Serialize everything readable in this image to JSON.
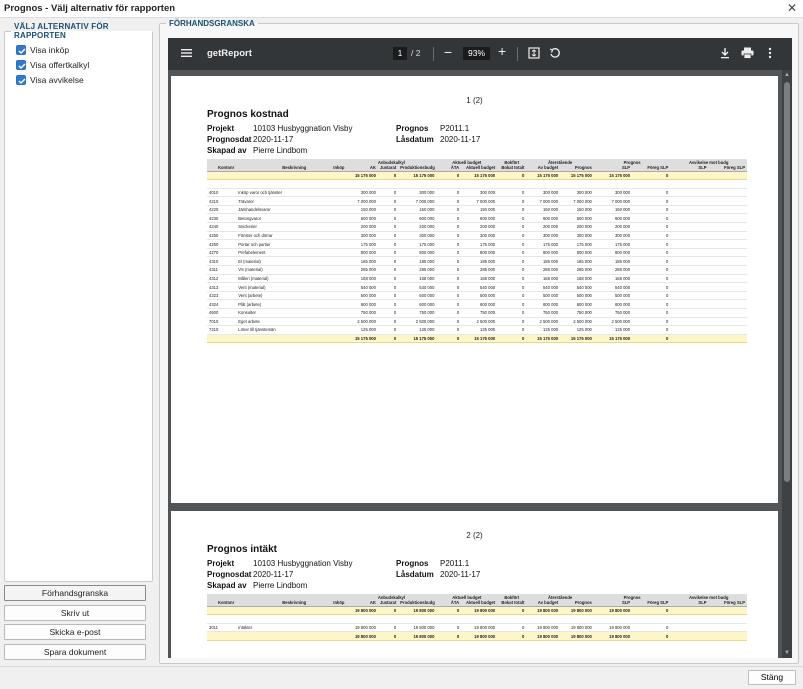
{
  "window": {
    "title": "Prognos - Välj alternativ för rapporten"
  },
  "options": {
    "legend": "VÄLJ ALTERNATIV FÖR RAPPORTEN",
    "items": [
      {
        "label": "Visa inköp",
        "checked": true
      },
      {
        "label": "Visa offertkalkyl",
        "checked": true
      },
      {
        "label": "Visa avvikelse",
        "checked": true
      }
    ]
  },
  "actions": {
    "preview": "Förhandsgranska",
    "print": "Skriv ut",
    "email": "Skicka e-post",
    "save": "Spara dokument"
  },
  "preview": {
    "legend": "FÖRHANDSGRANSKA"
  },
  "viewer": {
    "doc_name": "getReport",
    "page_current": "1",
    "page_total": "/ 2",
    "zoom": "93%"
  },
  "report": {
    "labels": {
      "project": "Projekt",
      "forecast_date": "Prognosdat",
      "created_by": "Skapad av",
      "forecast": "Prognos",
      "lock_date": "Låsdatum"
    },
    "project": "10103 Husbyggnation Visby",
    "forecast_date": "2020-11-17",
    "created_by": "Pierre Lindbom",
    "forecast": "P2011.1",
    "lock_date": "2020-11-17",
    "header_groups": [
      "Anbudskalkyl",
      "Aktuell budget",
      "Bokfört",
      "Återstående",
      "Prognos",
      "Avvikelse mot budg"
    ],
    "headers": [
      "Kontonr",
      "Beskrivning",
      "Inköp",
      "AK",
      "Justarat",
      "Produktionsbudg",
      "ÄTA",
      "Aktuell budget",
      "Bokat totalt",
      "Av budget",
      "Prognos",
      "SLP",
      "Föreg SLP",
      "SLP",
      "Föreg SLP"
    ],
    "cost": {
      "page_label": "1 (2)",
      "title": "Prognos kostnad",
      "top_total": [
        "15 175 000",
        "0",
        "15 175 000",
        "0",
        "15 175 000",
        "0",
        "15 175 000",
        "15 175 000",
        "15 175 000",
        "0"
      ],
      "rows": [
        [
          "4010",
          "Inköp varor och tjänster",
          "300 000",
          "0",
          "300 000",
          "0",
          "300 000",
          "0",
          "300 000",
          "300 000",
          "300 000",
          "0"
        ],
        [
          "4210",
          "Trävaror",
          "7 000 000",
          "0",
          "7 000 000",
          "0",
          "7 000 000",
          "0",
          "7 000 000",
          "7 000 000",
          "7 000 000",
          "0"
        ],
        [
          "4220",
          "Järnhandelsvaror",
          "150 000",
          "0",
          "150 000",
          "0",
          "150 000",
          "0",
          "150 000",
          "150 000",
          "150 000",
          "0"
        ],
        [
          "4230",
          "Betongvaror",
          "600 000",
          "0",
          "600 000",
          "0",
          "600 000",
          "0",
          "600 000",
          "600 000",
          "600 000",
          "0"
        ],
        [
          "4240",
          "Snickerier",
          "200 000",
          "0",
          "200 000",
          "0",
          "200 000",
          "0",
          "200 000",
          "200 000",
          "200 000",
          "0"
        ],
        [
          "4250",
          "Fönster och dörrar",
          "300 000",
          "0",
          "300 000",
          "0",
          "300 000",
          "0",
          "300 000",
          "300 000",
          "300 000",
          "0"
        ],
        [
          "4260",
          "Portar och partier",
          "175 000",
          "0",
          "175 000",
          "0",
          "175 000",
          "0",
          "175 000",
          "175 000",
          "175 000",
          "0"
        ],
        [
          "4270",
          "Prefabelement",
          "800 000",
          "0",
          "800 000",
          "0",
          "800 000",
          "0",
          "800 000",
          "800 000",
          "800 000",
          "0"
        ],
        [
          "4310",
          "El (material)",
          "185 000",
          "0",
          "185 000",
          "0",
          "185 000",
          "0",
          "185 000",
          "185 000",
          "185 000",
          "0"
        ],
        [
          "4311",
          "VS (material)",
          "285 000",
          "0",
          "285 000",
          "0",
          "285 000",
          "0",
          "285 000",
          "285 000",
          "285 000",
          "0"
        ],
        [
          "4312",
          "Måleri (material)",
          "168 000",
          "0",
          "168 000",
          "0",
          "168 000",
          "0",
          "168 000",
          "168 000",
          "168 000",
          "0"
        ],
        [
          "4313",
          "Vent (material)",
          "540 000",
          "0",
          "540 000",
          "0",
          "540 000",
          "0",
          "540 000",
          "540 000",
          "540 000",
          "0"
        ],
        [
          "4323",
          "Vent (arbete)",
          "500 000",
          "0",
          "500 000",
          "0",
          "500 000",
          "0",
          "500 000",
          "500 000",
          "500 000",
          "0"
        ],
        [
          "4324",
          "Plåt (arbete)",
          "600 000",
          "0",
          "600 000",
          "0",
          "600 000",
          "0",
          "600 000",
          "600 000",
          "600 000",
          "0"
        ],
        [
          "4600",
          "Konsulter",
          "750 000",
          "0",
          "750 000",
          "0",
          "750 000",
          "0",
          "750 000",
          "750 000",
          "750 000",
          "0"
        ],
        [
          "7010",
          "Eget arbete",
          "2 500 000",
          "0",
          "2 500 000",
          "0",
          "2 500 000",
          "0",
          "2 500 000",
          "2 500 000",
          "2 500 000",
          "0"
        ],
        [
          "7210",
          "Löner till tjänstemän",
          "125 000",
          "0",
          "125 000",
          "0",
          "125 000",
          "0",
          "125 000",
          "125 000",
          "125 000",
          "0"
        ]
      ],
      "bottom_total": [
        "15 175 000",
        "0",
        "15 175 000",
        "0",
        "15 175 000",
        "0",
        "15 175 000",
        "15 175 000",
        "15 175 000",
        "0"
      ]
    },
    "income": {
      "page_label": "2 (2)",
      "title": "Prognos intäkt",
      "top_total": [
        "19 800 000",
        "0",
        "19 800 000",
        "0",
        "19 800 000",
        "0",
        "19 800 000",
        "19 800 000",
        "19 800 000",
        "0"
      ],
      "rows": [
        [
          "3011",
          "Intäkter",
          "19 800 000",
          "0",
          "19 800 000",
          "0",
          "19 800 000",
          "0",
          "19 800 000",
          "19 800 000",
          "19 800 000",
          "0"
        ]
      ],
      "bottom_total": [
        "19 800 000",
        "0",
        "19 800 000",
        "0",
        "19 800 000",
        "0",
        "19 800 000",
        "19 800 000",
        "19 800 000",
        "0"
      ]
    }
  },
  "footer": {
    "close": "Stäng"
  },
  "colors": {
    "accent": "#2f7ad1",
    "legend": "#1b4f72",
    "viewer_toolbar": "#323639",
    "total_row": "#fff6c8"
  }
}
